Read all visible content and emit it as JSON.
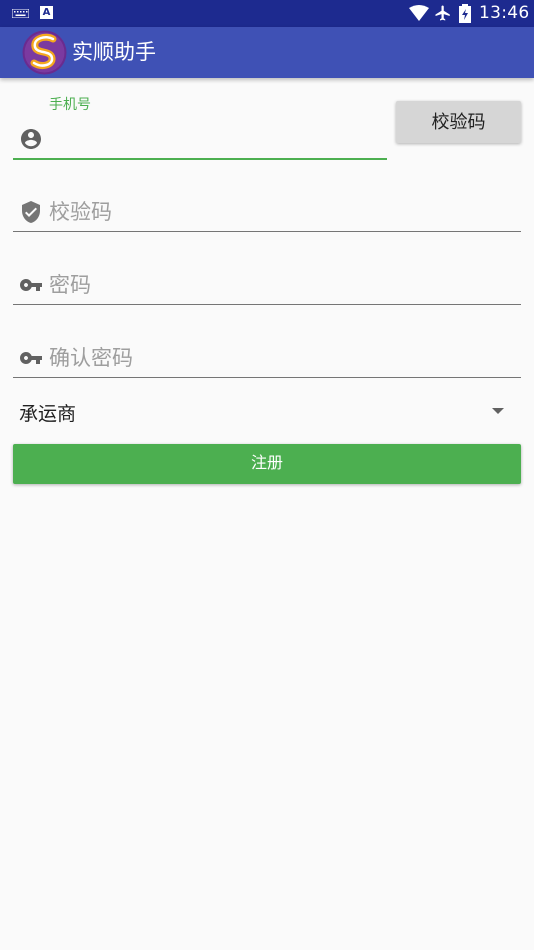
{
  "status_bar": {
    "time": "13:46",
    "left_icons": [
      "keyboard-icon",
      "a-notification-icon"
    ],
    "right_icons": [
      "wifi-icon",
      "airplane-icon",
      "battery-icon"
    ],
    "a_glyph": "A"
  },
  "app_bar": {
    "title": "实顺助手",
    "logo_icon": "app-logo-icon",
    "color": "#3f51b5"
  },
  "form": {
    "phone": {
      "label": "手机号",
      "value": "",
      "icon": "account-circle-icon"
    },
    "code_button": "校验码",
    "code": {
      "placeholder": "校验码",
      "icon": "shield-check-icon"
    },
    "password": {
      "placeholder": "密码",
      "icon": "key-icon"
    },
    "confirm_password": {
      "placeholder": "确认密码",
      "icon": "key-icon"
    },
    "carrier_select": {
      "selected": "承运商",
      "icon": "dropdown-arrow-icon"
    },
    "register_button": "注册"
  },
  "colors": {
    "accent": "#4caf50",
    "status_bar": "#1d2a8f",
    "background": "#fafafa"
  }
}
